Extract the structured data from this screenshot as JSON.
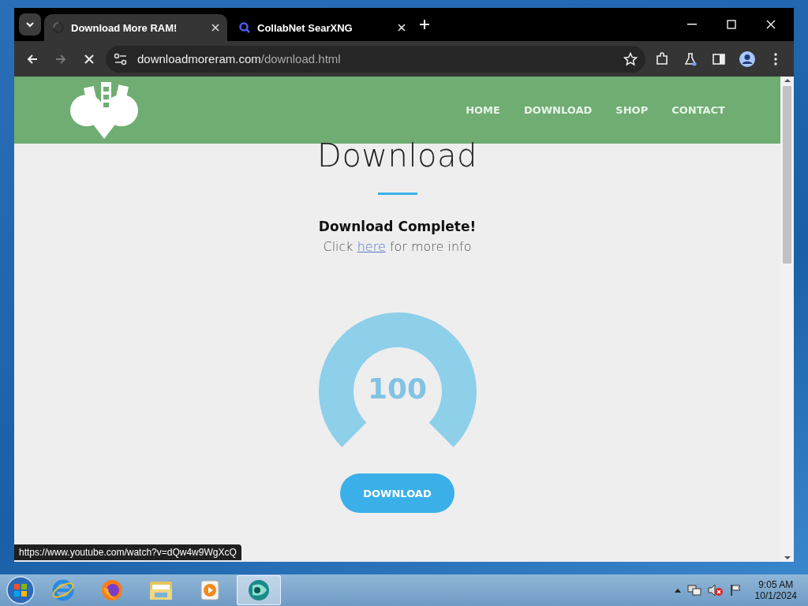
{
  "browser": {
    "tabs": [
      {
        "title": "Download More RAM!",
        "selected": true
      },
      {
        "title": "CollabNet SearXNG",
        "selected": false
      }
    ],
    "url": {
      "host": "downloadmoreram.com",
      "path": "/download.html"
    }
  },
  "site": {
    "nav": [
      {
        "label": "HOME"
      },
      {
        "label": "DOWNLOAD"
      },
      {
        "label": "SHOP"
      },
      {
        "label": "CONTACT"
      }
    ],
    "heading": "Download",
    "status_title": "Download Complete!",
    "info": {
      "before": "Click",
      "link": "here",
      "after": "for more info"
    },
    "gauge": {
      "value": "100",
      "level": 1
    },
    "button": "DOWNLOAD"
  },
  "status_url": "https://www.youtube.com/watch?v=dQw4w9WgXcQ",
  "taskbar": {
    "apps": [
      {
        "kind": "ie",
        "selected": false
      },
      {
        "kind": "firefox",
        "selected": false
      },
      {
        "kind": "folder",
        "selected": false
      },
      {
        "kind": "media",
        "selected": false
      },
      {
        "kind": "app",
        "selected": true
      }
    ],
    "time": "9:05 AM",
    "date": "10/1/2024"
  }
}
